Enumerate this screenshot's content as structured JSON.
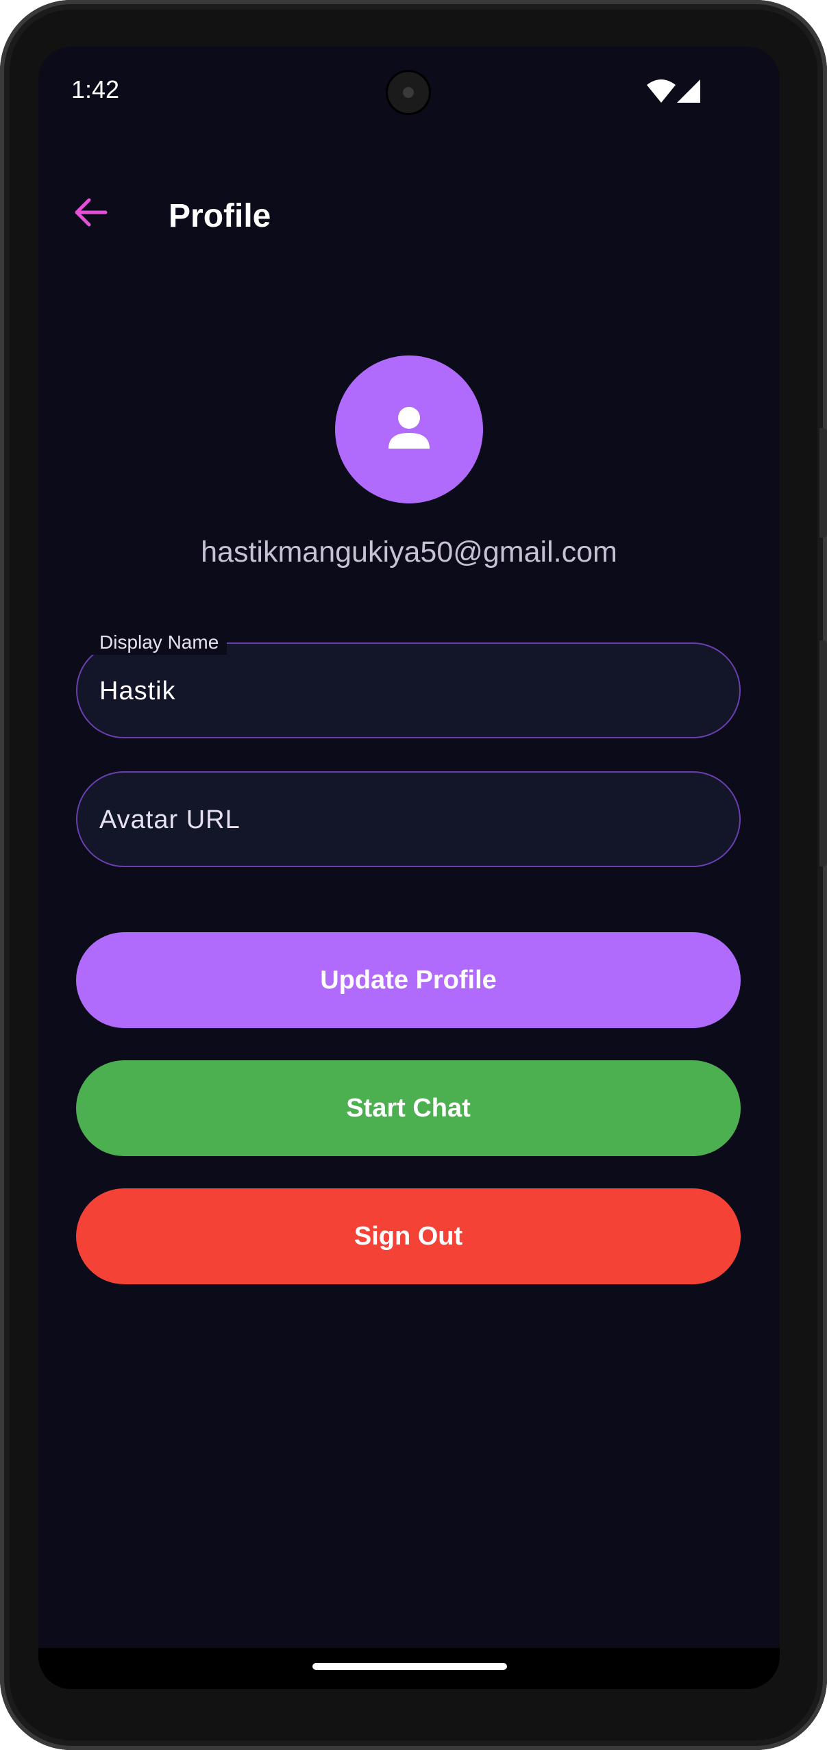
{
  "status_bar": {
    "time": "1:42",
    "icons": [
      "wifi-icon",
      "cellular-signal-icon"
    ]
  },
  "app_bar": {
    "back_icon": "arrow-back-icon",
    "title": "Profile"
  },
  "profile": {
    "avatar_icon": "person-icon",
    "email": "hastikmangukiya50@gmail.com"
  },
  "form": {
    "display_name": {
      "label": "Display Name",
      "value": "Hastik"
    },
    "avatar_url": {
      "placeholder": "Avatar URL",
      "value": ""
    }
  },
  "actions": {
    "update_label": "Update Profile",
    "chat_label": "Start Chat",
    "signout_label": "Sign Out"
  },
  "colors": {
    "background": "#0b0b1a",
    "accent_purple": "#b06bfc",
    "back_arrow": "#e64fd8",
    "start_chat_green": "#4caf50",
    "sign_out_red": "#f44336",
    "field_border": "#6a3fb0",
    "field_fill": "#131528"
  }
}
